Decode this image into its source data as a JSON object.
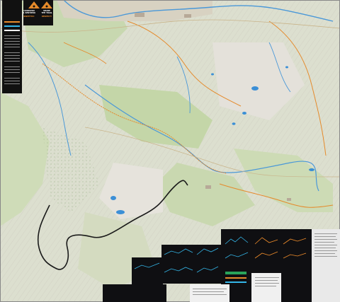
{
  "map": {
    "signs": [
      {
        "line1": "CONDIVIDI",
        "line2": "IL SENTIERO",
        "line3": "RISPETTA!"
      },
      {
        "line1": "SHARE",
        "line2": "THE TRAIL",
        "line3": "RESPECT!"
      }
    ],
    "colors": {
      "terrain": "#dcdfcf",
      "forest": "#b9cfa3",
      "rock": "#e6e3dc",
      "lake": "#3b8fd6",
      "river": "#4a98d8",
      "trail_orange": "#e58a2b",
      "route_black": "#1a1a1a",
      "panel_bg": "#0f0f12",
      "chart_cyan": "#34b6e8",
      "chart_orange": "#f08d2b"
    }
  }
}
